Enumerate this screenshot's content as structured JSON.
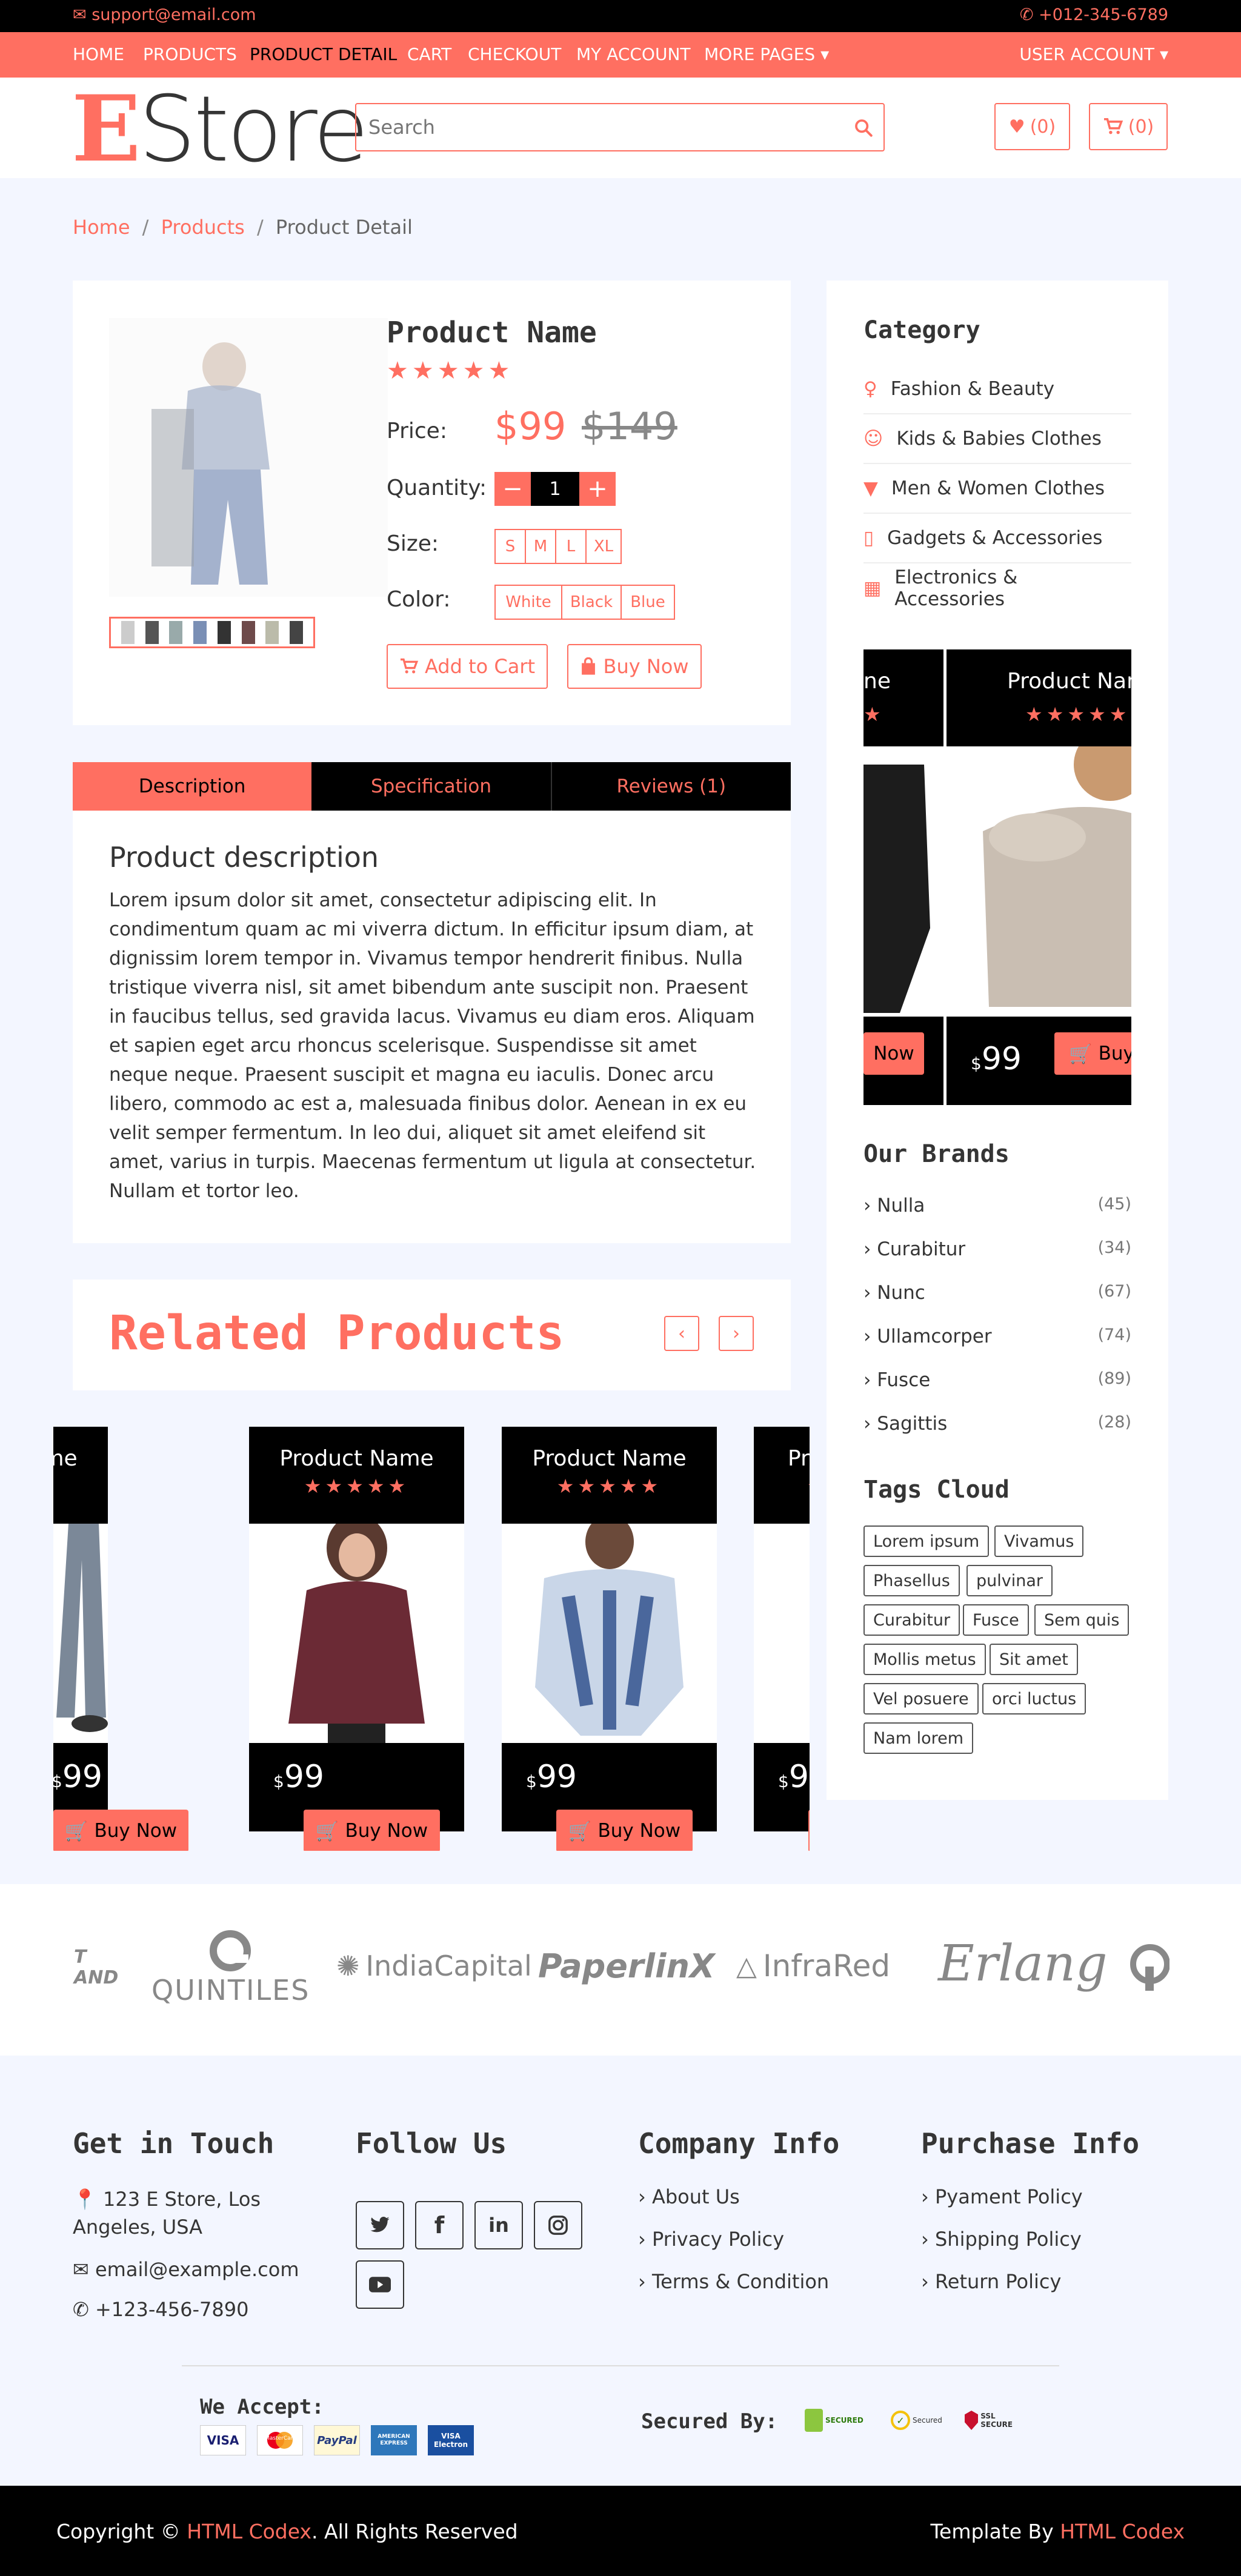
{
  "topbar": {
    "email": "support@email.com",
    "phone": "+012-345-6789"
  },
  "nav": {
    "items": [
      "HOME",
      "PRODUCTS",
      "PRODUCT DETAIL",
      "CART",
      "CHECKOUT",
      "MY ACCOUNT",
      "MORE PAGES"
    ],
    "account": "USER ACCOUNT"
  },
  "header": {
    "logo_first": "E",
    "logo_rest": "Store",
    "search_placeholder": "Search",
    "wishlist_count": "(0)",
    "cart_count": "(0)"
  },
  "breadcrumb": [
    "Home",
    "Products",
    "Product Detail"
  ],
  "product": {
    "name": "Product Name",
    "rating_stars": 5,
    "price_label": "Price:",
    "price": "$99",
    "old_price": "$149",
    "quantity_label": "Quantity:",
    "quantity": "1",
    "size_label": "Size:",
    "sizes": [
      "S",
      "M",
      "L",
      "XL"
    ],
    "color_label": "Color:",
    "colors": [
      "White",
      "Black",
      "Blue"
    ],
    "add_to_cart": "Add to Cart",
    "buy_now": "Buy Now"
  },
  "tabs": [
    "Description",
    "Specification",
    "Reviews (1)"
  ],
  "description": {
    "title": "Product description",
    "text": "Lorem ipsum dolor sit amet, consectetur adipiscing elit. In condimentum quam ac mi viverra dictum. In efficitur ipsum diam, at dignissim lorem tempor in. Vivamus tempor hendrerit finibus. Nulla tristique viverra nisl, sit amet bibendum ante suscipit non. Praesent in faucibus tellus, sed gravida lacus. Vivamus eu diam eros. Aliquam et sapien eget arcu rhoncus scelerisque. Suspendisse sit amet neque neque. Praesent suscipit et magna eu iaculis. Donec arcu libero, commodo ac est a, malesuada finibus dolor. Aenean in ex eu velit semper fermentum. In leo dui, aliquet sit amet eleifend sit amet, varius in turpis. Maecenas fermentum ut ligula at consectetur. Nullam et tortor leo."
  },
  "related": {
    "title": "Related Products",
    "cards": [
      {
        "name": "oduct Name",
        "currency": "$",
        "price": "99",
        "buy": "Buy Now"
      },
      {
        "name": "Product Name",
        "currency": "$",
        "price": "99",
        "buy": "Buy Now"
      },
      {
        "name": "Product Name",
        "currency": "$",
        "price": "99",
        "buy": "Buy Now"
      },
      {
        "name": "Pr",
        "currency": "$",
        "price": "9",
        "buy": ""
      }
    ]
  },
  "sidebar": {
    "category_title": "Category",
    "categories": [
      "Fashion & Beauty",
      "Kids & Babies Clothes",
      "Men & Women Clothes",
      "Gadgets & Accessories",
      "Electronics & Accessories"
    ],
    "widget": {
      "name_left": "ne",
      "name_right": "Product Nam",
      "buy_left": "Now",
      "currency": "$",
      "price": "99",
      "buy_right": "Buy"
    },
    "brands_title": "Our Brands",
    "brands": [
      {
        "name": "Nulla",
        "count": "(45)"
      },
      {
        "name": "Curabitur",
        "count": "(34)"
      },
      {
        "name": "Nunc",
        "count": "(67)"
      },
      {
        "name": "Ullamcorper",
        "count": "(74)"
      },
      {
        "name": "Fusce",
        "count": "(89)"
      },
      {
        "name": "Sagittis",
        "count": "(28)"
      }
    ],
    "tags_title": "Tags Cloud",
    "tags": [
      "Lorem ipsum",
      "Vivamus",
      "Phasellus",
      "pulvinar",
      "Curabitur",
      "Fusce",
      "Sem quis",
      "Mollis metus",
      "Sit amet",
      "Vel posuere",
      "orci luctus",
      "Nam lorem"
    ]
  },
  "brand_logos": [
    "T AND",
    "QUINTILES",
    "IndiaCapital",
    "PaperlinX",
    "InfraRed",
    "Erlang"
  ],
  "footer": {
    "touch_title": "Get in Touch",
    "address": "123 E Store, Los Angeles, USA",
    "email": "email@example.com",
    "phone": "+123-456-7890",
    "follow_title": "Follow Us",
    "company_title": "Company Info",
    "company_links": [
      "About Us",
      "Privacy Policy",
      "Terms & Condition"
    ],
    "purchase_title": "Purchase Info",
    "purchase_links": [
      "Pyament Policy",
      "Shipping Policy",
      "Return Policy"
    ],
    "we_accept": "We Accept:",
    "secured_by": "Secured By:",
    "payment_logos": [
      "VISA",
      "MasterCard",
      "PayPal",
      "AMERICAN EXPRESS",
      "VISA Electron"
    ],
    "secure_logos": [
      "SECURED",
      "Secured",
      "SSL SECURE"
    ]
  },
  "bottom": {
    "copy_prefix": "Copyright ©",
    "copy_brand": "HTML Codex",
    "copy_suffix": ". All Rights Reserved",
    "tmpl_prefix": "Template By",
    "tmpl_brand": "HTML Codex"
  }
}
